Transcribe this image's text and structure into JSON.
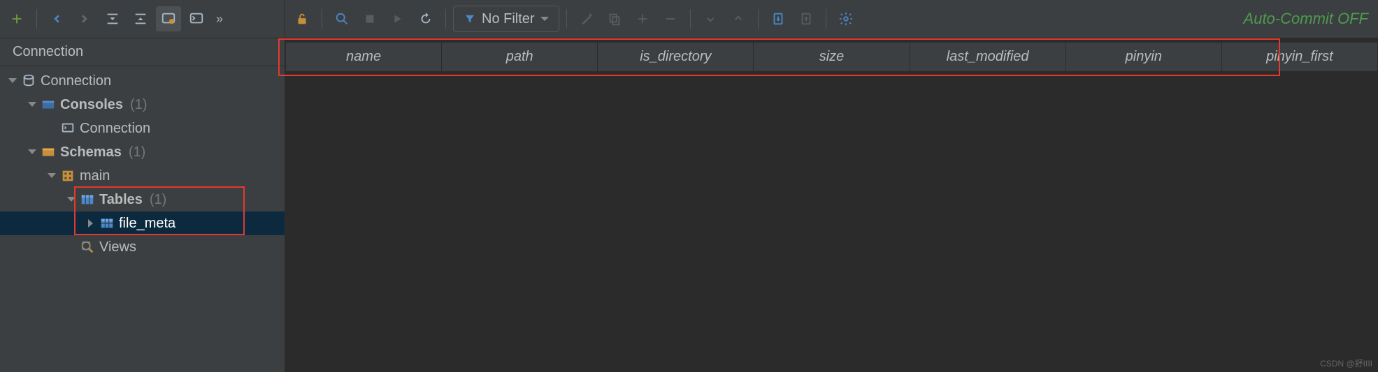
{
  "left_toolbar": {
    "overflow": "»"
  },
  "panel_title": "Connection",
  "tree": {
    "root": {
      "label": "Connection"
    },
    "consoles": {
      "label": "Consoles",
      "count": "(1)"
    },
    "console_item": {
      "label": "Connection"
    },
    "schemas": {
      "label": "Schemas",
      "count": "(1)"
    },
    "main_schema": {
      "label": "main"
    },
    "tables": {
      "label": "Tables",
      "count": "(1)"
    },
    "file_meta": {
      "label": "file_meta"
    },
    "views": {
      "label": "Views"
    }
  },
  "right_toolbar": {
    "filter_label": "No Filter",
    "commit_label": "Auto-Commit OFF"
  },
  "columns": [
    "name",
    "path",
    "is_directory",
    "size",
    "last_modified",
    "pinyin",
    "pinyin_first"
  ],
  "watermark": "CSDN @舒IIII"
}
